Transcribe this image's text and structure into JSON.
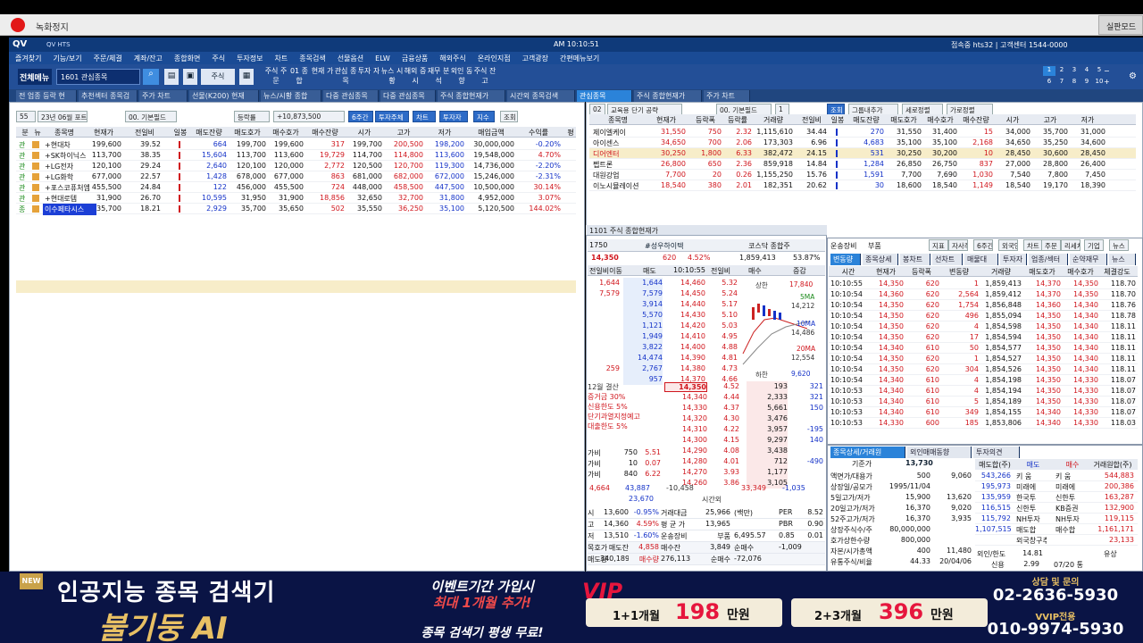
{
  "recorder": {
    "title": "녹화정지",
    "right_button": "실판모드"
  },
  "app": {
    "logo": "QV",
    "sub": "QV HTS",
    "clock": "AM 10:10:51",
    "connection": "접속중 hts32 | 고객센터 1544-0000"
  },
  "menu": [
    "즐겨찾기",
    "기능/보기",
    "주문/체결",
    "계좌/잔고",
    "종합화면",
    "주식",
    "투자정보",
    "차트",
    "종목검색",
    "선물옵션",
    "ELW",
    "금융상품",
    "해외주식",
    "온라인지점",
    "고객광장",
    "간편메뉴보기"
  ],
  "toolbar": {
    "all_menu": "전체메뉴",
    "screen_combo": "1601 관심종목",
    "market": "주식",
    "items": [
      "주식 주문",
      "01 종합",
      "현재 가",
      "관심 종목",
      "투자 자",
      "뉴스 시황",
      "해외 증시",
      "재무 분석",
      "외인 동향",
      "주식 잔고"
    ],
    "numpad": [
      "1",
      "2",
      "3",
      "4",
      "5",
      "6",
      "7",
      "8",
      "9",
      "10"
    ]
  },
  "tabs": [
    "전 업종 등락 현",
    "추천섹터 종목검",
    "주가 차트",
    "선물(K200) 현재",
    "뉴스/시황 종합",
    "다중 관심종목",
    "다중 관심종목",
    "주식 종합현재가",
    "시간외 종목검색",
    "관심종목",
    "주식 종합현재가",
    "주가 차트"
  ],
  "left": {
    "tools": [
      "55",
      "23년 06월 포트",
      "00. 기본필드",
      "등락률",
      "+10,873,500",
      "6주간",
      "투자주체",
      "차트",
      "투자자",
      "지수",
      "조회"
    ],
    "headers": [
      "분",
      "뉴",
      "종목명",
      "현재가",
      "전일비",
      "일봉",
      "매도잔량",
      "매도호가",
      "매수호가",
      "매수잔량",
      "시가",
      "고가",
      "저가",
      "매입금액",
      "수익률",
      "평"
    ],
    "rows": [
      {
        "g": "관",
        "n": "+현대차",
        "p": "199,600",
        "c": "39.52",
        "ad": "664",
        "ask": "199,700",
        "bid": "199,600",
        "bq": "317",
        "o": "199,700",
        "h": "200,500",
        "l": "198,200",
        "amt": "30,000,000",
        "rt": "-0.20%"
      },
      {
        "g": "관",
        "n": "+SK하이닉스",
        "p": "113,700",
        "c": "38.35",
        "ad": "15,604",
        "ask": "113,700",
        "bid": "113,600",
        "bq": "19,729",
        "o": "114,700",
        "h": "114,800",
        "l": "113,600",
        "amt": "19,548,000",
        "rt": "4.70%"
      },
      {
        "g": "관",
        "n": "+LG전자",
        "p": "120,100",
        "c": "29.24",
        "ad": "2,640",
        "ask": "120,100",
        "bid": "120,000",
        "bq": "2,772",
        "o": "120,500",
        "h": "120,700",
        "l": "119,300",
        "amt": "14,736,000",
        "rt": "-2.20%"
      },
      {
        "g": "관",
        "n": "+LG화학",
        "p": "677,000",
        "c": "22.57",
        "ad": "1,428",
        "ask": "678,000",
        "bid": "677,000",
        "bq": "863",
        "o": "681,000",
        "h": "682,000",
        "l": "672,000",
        "amt": "15,246,000",
        "rt": "-2.31%"
      },
      {
        "g": "관",
        "n": "+포스코퓨처엠",
        "p": "455,500",
        "c": "24.84",
        "ad": "122",
        "ask": "456,000",
        "bid": "455,500",
        "bq": "724",
        "o": "448,000",
        "h": "458,500",
        "l": "447,500",
        "amt": "10,500,000",
        "rt": "30.14%"
      },
      {
        "g": "관",
        "n": "+현대로템",
        "p": "31,900",
        "c": "26.70",
        "ad": "10,595",
        "ask": "31,950",
        "bid": "31,900",
        "bq": "18,856",
        "o": "32,650",
        "h": "32,700",
        "l": "31,800",
        "amt": "4,952,000",
        "rt": "3.07%"
      },
      {
        "g": "종",
        "n": "이수페타시스",
        "p": "35,700",
        "c": "18.21",
        "ad": "2,929",
        "ask": "35,700",
        "bid": "35,650",
        "bq": "502",
        "o": "35,550",
        "h": "36,250",
        "l": "35,100",
        "amt": "5,120,500",
        "rt": "144.02%"
      }
    ]
  },
  "right_top": {
    "tools": [
      "02",
      "교육용 단기 공략",
      "00. 기본필드",
      "1",
      "조회",
      "그룹내추가",
      "세로정렬",
      "가로정렬"
    ],
    "headers": [
      "종목명",
      "현재가",
      "등락폭",
      "등락률",
      "거래량",
      "전일비",
      "일봉",
      "매도잔량",
      "매도호가",
      "매수호가",
      "매수잔량",
      "시가",
      "고가",
      "저가"
    ],
    "rows": [
      {
        "n": "제이엘케이",
        "p": "31,550",
        "d": "750",
        "r": "2.32",
        "v": "1,115,610",
        "b": "34.44",
        "aq": "270",
        "a": "31,550",
        "bd": "31,400",
        "bq": "15",
        "o": "34,000",
        "h": "35,700",
        "l": "31,000",
        "hl": false
      },
      {
        "n": "아이센스",
        "p": "34,650",
        "d": "700",
        "r": "2.06",
        "v": "173,303",
        "b": "6.96",
        "aq": "4,683",
        "a": "35,100",
        "bd": "35,100",
        "bq": "2,168",
        "o": "34,650",
        "h": "35,250",
        "l": "34,600",
        "hl": false
      },
      {
        "n": "디어엔터",
        "p": "30,250",
        "d": "1,800",
        "r": "6.33",
        "v": "382,472",
        "b": "24.15",
        "aq": "531",
        "a": "30,250",
        "bd": "30,200",
        "bq": "10",
        "o": "28,450",
        "h": "30,600",
        "l": "28,450",
        "hl": true
      },
      {
        "n": "펩트론",
        "p": "26,800",
        "d": "650",
        "r": "2.36",
        "v": "859,918",
        "b": "14.84",
        "aq": "1,284",
        "a": "26,850",
        "bd": "26,750",
        "bq": "837",
        "o": "27,000",
        "h": "28,800",
        "l": "26,400",
        "hl": false
      },
      {
        "n": "대원강업",
        "p": "7,700",
        "d": "20",
        "r": "0.26",
        "v": "1,155,250",
        "b": "15.76",
        "aq": "1,591",
        "a": "7,700",
        "bd": "7,690",
        "bq": "1,030",
        "o": "7,540",
        "h": "7,800",
        "l": "7,450",
        "hl": false
      },
      {
        "n": "이노시뮬레이션",
        "p": "18,540",
        "d": "380",
        "r": "2.01",
        "v": "182,351",
        "b": "20.62",
        "aq": "30",
        "a": "18,600",
        "bd": "18,540",
        "bq": "1,149",
        "o": "18,540",
        "h": "19,170",
        "l": "18,390",
        "hl": false
      }
    ]
  },
  "order": {
    "title": "1101 주식 종합현재가",
    "code": "1750",
    "name": "#성우하이텍",
    "market": "코스닥 종합주",
    "price": "14,350",
    "change": "620",
    "rate": "4.52%",
    "volume": "1,859,413",
    "vol_ratio": "53.87%",
    "head": [
      "전일비이동",
      "매도",
      "10:10:55",
      "전일비",
      "매수",
      "증감"
    ],
    "asks": [
      {
        "prev": "1,644",
        "q": "1,644",
        "p": "14,460",
        "r": "5.32"
      },
      {
        "prev": "7,579",
        "q": "7,579",
        "p": "14,450",
        "r": "5.24"
      },
      {
        "prev": "",
        "q": "3,914",
        "p": "14,440",
        "r": "5.17"
      },
      {
        "prev": "",
        "q": "5,570",
        "p": "14,430",
        "r": "5.10"
      },
      {
        "prev": "",
        "q": "1,121",
        "p": "14,420",
        "r": "5.03"
      },
      {
        "prev": "",
        "q": "1,949",
        "p": "14,410",
        "r": "4.95"
      },
      {
        "prev": "",
        "q": "3,822",
        "p": "14,400",
        "r": "4.88"
      },
      {
        "prev": "",
        "q": "14,474",
        "p": "14,390",
        "r": "4.81"
      },
      {
        "prev": "259",
        "q": "2,767",
        "p": "14,380",
        "r": "4.73"
      },
      {
        "prev": "",
        "q": "957",
        "p": "14,370",
        "r": "4.66"
      }
    ],
    "bids": [
      {
        "p": "14,350",
        "r": "4.52",
        "q": "193",
        "d": "321"
      },
      {
        "p": "14,340",
        "r": "4.44",
        "q": "2,333",
        "d": "321"
      },
      {
        "p": "14,330",
        "r": "4.37",
        "q": "5,661",
        "d": "150"
      },
      {
        "p": "14,320",
        "r": "4.30",
        "q": "3,476",
        "d": ""
      },
      {
        "p": "14,310",
        "r": "4.22",
        "q": "3,957",
        "d": "-195"
      },
      {
        "p": "14,300",
        "r": "4.15",
        "q": "9,297",
        "d": "140"
      },
      {
        "p": "14,290",
        "r": "4.08",
        "q": "3,438",
        "d": ""
      },
      {
        "p": "14,280",
        "r": "4.01",
        "q": "712",
        "d": "-490"
      },
      {
        "p": "14,270",
        "r": "3.93",
        "q": "1,177",
        "d": ""
      },
      {
        "p": "14,260",
        "r": "3.86",
        "q": "3,105",
        "d": ""
      }
    ],
    "side_labels": [
      "12월 결산",
      "증거금 30%",
      "신용한도 5%",
      "단기과열지정예고",
      "대출한도 5%"
    ],
    "chart_labels": {
      "upper": "상한",
      "upper_v": "17,840",
      "lower": "하한",
      "lower_v": "9,620",
      "ma5": "5MA",
      "ma5_v": "14,212",
      "ma10": "10MA",
      "ma10_v": "14,486",
      "ma20": "20MA",
      "ma20_v": "12,554"
    },
    "vi": [
      {
        "k": "가비",
        "a": "750",
        "b": "5.51"
      },
      {
        "k": "가비",
        "a": "10",
        "b": "0.07"
      },
      {
        "k": "가비",
        "a": "840",
        "b": "6.22"
      }
    ],
    "totals": {
      "ask": "43,887",
      "diff": "-10,458",
      "bid": "33,349",
      "chg": "-1,035",
      "left": "4,664",
      "after": "23,670",
      "after_label": "시간외"
    },
    "stats": [
      {
        "k": "시",
        "v": "13,600",
        "r": "-0.95%",
        "k2": "거래대금",
        "v2": "25,966",
        "u": "(백만)",
        "k3": "PER",
        "v3": "8.52"
      },
      {
        "k": "고",
        "v": "14,360",
        "r": "4.59%",
        "k2": "평 균 가",
        "v2": "13,965",
        "u": "",
        "k3": "PBR",
        "v3": "0.90"
      },
      {
        "k": "저",
        "v": "13,510",
        "r": "-1.60%",
        "k2": "운송장비",
        "v2": "부품",
        "u": "6,495.57",
        "k3": "0.85",
        "v3": "0.01"
      },
      {
        "k": "목호가",
        "v": "매도잔",
        "r": "4,858",
        "k2": "매수잔",
        "v2": "3,849",
        "u": "순매수",
        "k3": "-1,009",
        "v3": ""
      },
      {
        "k": "매도량",
        "v": "340,189",
        "r": "매수량",
        "k2": "276,113",
        "v2": "순매수",
        "u": "-72,076",
        "k3": "",
        "v3": ""
      }
    ]
  },
  "tick": {
    "toolbar": [
      "운송장비",
      "부품",
      "지표",
      "자사주",
      "6주간",
      "외국인",
      "차트",
      "주문",
      "리세치",
      "기업",
      "뉴스"
    ],
    "tabs": [
      "변동량",
      "종목상세",
      "봉차트",
      "선차트",
      "매물대",
      "투자자",
      "업종/섹터",
      "순약재무",
      "뉴스"
    ],
    "headers": [
      "시간",
      "현재가",
      "등락폭",
      "변동량",
      "거래량",
      "매도호가",
      "매수호가",
      "체결강도"
    ],
    "rows": [
      [
        "10:10:55",
        "14,350",
        "620",
        "1",
        "1,859,413",
        "14,370",
        "14,350",
        "118.70"
      ],
      [
        "10:10:54",
        "14,360",
        "620",
        "2,564",
        "1,859,412",
        "14,370",
        "14,350",
        "118.70"
      ],
      [
        "10:10:54",
        "14,350",
        "620",
        "1,754",
        "1,856,848",
        "14,360",
        "14,340",
        "118.76"
      ],
      [
        "10:10:54",
        "14,350",
        "620",
        "496",
        "1,855,094",
        "14,350",
        "14,340",
        "118.78"
      ],
      [
        "10:10:54",
        "14,350",
        "620",
        "4",
        "1,854,598",
        "14,350",
        "14,340",
        "118.11"
      ],
      [
        "10:10:54",
        "14,350",
        "620",
        "17",
        "1,854,594",
        "14,350",
        "14,340",
        "118.11"
      ],
      [
        "10:10:54",
        "14,340",
        "610",
        "50",
        "1,854,577",
        "14,350",
        "14,340",
        "118.11"
      ],
      [
        "10:10:54",
        "14,350",
        "620",
        "1",
        "1,854,527",
        "14,350",
        "14,340",
        "118.11"
      ],
      [
        "10:10:54",
        "14,350",
        "620",
        "304",
        "1,854,526",
        "14,350",
        "14,340",
        "118.11"
      ],
      [
        "10:10:54",
        "14,340",
        "610",
        "4",
        "1,854,198",
        "14,350",
        "14,330",
        "118.07"
      ],
      [
        "10:10:53",
        "14,340",
        "610",
        "4",
        "1,854,194",
        "14,350",
        "14,330",
        "118.07"
      ],
      [
        "10:10:53",
        "14,340",
        "610",
        "5",
        "1,854,189",
        "14,350",
        "14,330",
        "118.07"
      ],
      [
        "10:10:53",
        "14,340",
        "610",
        "349",
        "1,854,155",
        "14,340",
        "14,330",
        "118.07"
      ],
      [
        "10:10:53",
        "14,330",
        "600",
        "185",
        "1,853,806",
        "14,340",
        "14,330",
        "118.03"
      ]
    ]
  },
  "info": {
    "tabs": [
      "종목상세/거래원",
      "외인매매동향",
      "투자의견"
    ],
    "base_label": "기준가",
    "base": "13,730",
    "rows": [
      [
        "액면가/대용가",
        "500",
        "9,060"
      ],
      [
        "상장일/공모가",
        "1995/11/04",
        ""
      ],
      [
        "5일고가/저가",
        "15,900",
        "13,620"
      ],
      [
        "20일고가/저가",
        "16,370",
        "9,020"
      ],
      [
        "52주고가/저가",
        "16,370",
        "3,935"
      ],
      [
        "상장주식수/주",
        "80,000,000",
        ""
      ],
      [
        "호가상한수량",
        "800,000",
        ""
      ],
      [
        "자본/시가총액",
        "400",
        "11,480"
      ],
      [
        "유통주식/비율",
        "44.33",
        "20/04/06"
      ]
    ],
    "broker_head": [
      "매도합(주)",
      "매도",
      "매수",
      "거래원합(주)"
    ],
    "brokers": [
      [
        "543,266",
        "키 움",
        "키 움",
        "544,883"
      ],
      [
        "195,973",
        "미래에",
        "미래에",
        "200,386"
      ],
      [
        "135,959",
        "한국투",
        "신한투",
        "163,287"
      ],
      [
        "116,515",
        "신한투",
        "KB증권",
        "132,900"
      ],
      [
        "115,792",
        "NH투자",
        "NH투자",
        "119,115"
      ],
      [
        "1,107,515",
        "매도합",
        "매수합",
        "1,161,171"
      ],
      [
        "",
        "외국창구추정",
        "",
        "23,133"
      ]
    ],
    "foreign": "외인/한도",
    "foreign_v": "14.81",
    "rating": "유상",
    "credit": "신용",
    "credit_v": "2.99",
    "credit_d": "07/20 통"
  },
  "ad": {
    "new": "NEW",
    "title": "인공지능 종목 검색기",
    "ai": "불기둥 AI",
    "event1": "이벤트기간 가입시",
    "event2": "최대 1개월 추가!",
    "event3": "종목 검색기 평생 무료!",
    "vip": "VIP",
    "plan1": "1+1개월",
    "price1": "198",
    "unit1": "만원",
    "plan2": "2+3개월",
    "price2": "396",
    "unit2": "만원",
    "contact_label": "상담 및 문의",
    "phone1": "02-2636-5930",
    "vvip": "VVIP전용",
    "phone2": "010-9974-5930"
  }
}
